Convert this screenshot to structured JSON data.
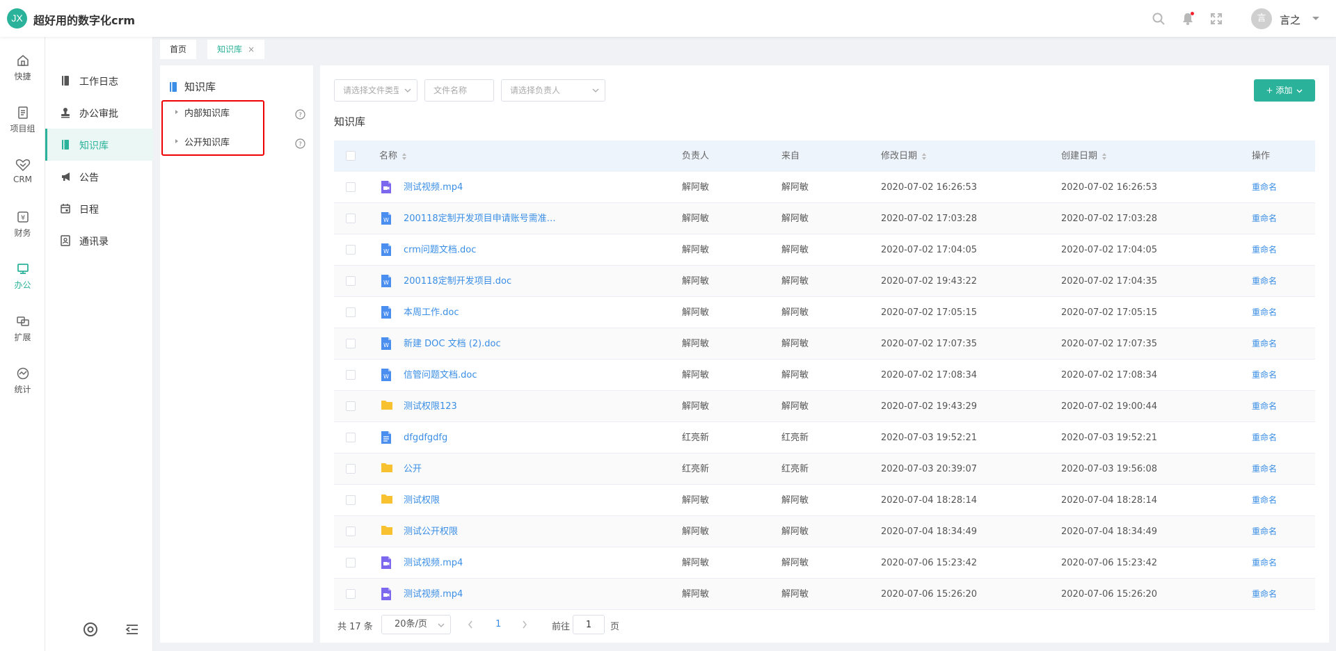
{
  "app": {
    "logo_text": "JX",
    "title": "超好用的数字化crm"
  },
  "user": {
    "avatar_text": "言",
    "name": "言之"
  },
  "rail": [
    {
      "label": "快捷",
      "icon": "home-icon"
    },
    {
      "label": "项目组",
      "icon": "document-icon"
    },
    {
      "label": "CRM",
      "icon": "handshake-icon"
    },
    {
      "label": "财务",
      "icon": "finance-icon"
    },
    {
      "label": "办公",
      "icon": "monitor-icon",
      "active": true
    },
    {
      "label": "扩展",
      "icon": "extend-icon"
    },
    {
      "label": "统计",
      "icon": "stats-icon"
    }
  ],
  "submenu": [
    {
      "label": "工作日志",
      "icon": "journal-icon"
    },
    {
      "label": "办公审批",
      "icon": "stamp-icon"
    },
    {
      "label": "知识库",
      "icon": "knowledge-icon",
      "active": true
    },
    {
      "label": "公告",
      "icon": "megaphone-icon"
    },
    {
      "label": "日程",
      "icon": "calendar-icon"
    },
    {
      "label": "通讯录",
      "icon": "contacts-icon"
    }
  ],
  "tabs": [
    {
      "label": "首页"
    },
    {
      "label": "知识库",
      "close": "×",
      "active": true
    }
  ],
  "tree": {
    "title": "知识库",
    "nodes": [
      {
        "label": "内部知识库"
      },
      {
        "label": "公开知识库"
      }
    ]
  },
  "filters": {
    "file_type_placeholder": "请选择文件类型",
    "file_name_placeholder": "文件名称",
    "owner_placeholder": "请选择负责人"
  },
  "add_button": "添加",
  "main_title": "知识库",
  "table": {
    "headers": {
      "name": "名称",
      "owner": "负责人",
      "source": "来自",
      "modified": "修改日期",
      "created": "创建日期",
      "action": "操作"
    },
    "rows": [
      {
        "type": "video",
        "name": "测试视频.mp4",
        "owner": "解阿敏",
        "source": "解阿敏",
        "modified": "2020-07-02 16:26:53",
        "created": "2020-07-02 16:26:53",
        "action": "重命名"
      },
      {
        "type": "word",
        "name": " 200118定制开发项目申请账号需准备...",
        "owner": "解阿敏",
        "source": "解阿敏",
        "modified": "2020-07-02 17:03:28",
        "created": "2020-07-02 17:03:28",
        "action": "重命名"
      },
      {
        "type": "word",
        "name": "crm问题文档.doc",
        "owner": "解阿敏",
        "source": "解阿敏",
        "modified": "2020-07-02 17:04:05",
        "created": "2020-07-02 17:04:05",
        "action": "重命名"
      },
      {
        "type": "word",
        "name": "200118定制开发项目.doc",
        "owner": "解阿敏",
        "source": "解阿敏",
        "modified": "2020-07-02 19:43:22",
        "created": "2020-07-02 17:04:35",
        "action": "重命名"
      },
      {
        "type": "word",
        "name": "本周工作.doc",
        "owner": "解阿敏",
        "source": "解阿敏",
        "modified": "2020-07-02 17:05:15",
        "created": "2020-07-02 17:05:15",
        "action": "重命名"
      },
      {
        "type": "word",
        "name": "新建 DOC 文档 (2).doc",
        "owner": "解阿敏",
        "source": "解阿敏",
        "modified": "2020-07-02 17:07:35",
        "created": "2020-07-02 17:07:35",
        "action": "重命名"
      },
      {
        "type": "word",
        "name": "信管问题文档.doc",
        "owner": "解阿敏",
        "source": "解阿敏",
        "modified": "2020-07-02 17:08:34",
        "created": "2020-07-02 17:08:34",
        "action": "重命名"
      },
      {
        "type": "folder",
        "name": "测试权限123",
        "owner": "解阿敏",
        "source": "解阿敏",
        "modified": "2020-07-02 19:43:29",
        "created": "2020-07-02 19:00:44",
        "action": "重命名"
      },
      {
        "type": "text",
        "name": "dfgdfgdfg",
        "owner": "红亮新",
        "source": "红亮新",
        "modified": "2020-07-03 19:52:21",
        "created": "2020-07-03 19:52:21",
        "action": "重命名"
      },
      {
        "type": "folder",
        "name": "公开",
        "owner": "红亮新",
        "source": "红亮新",
        "modified": "2020-07-03 20:39:07",
        "created": "2020-07-03 19:56:08",
        "action": "重命名"
      },
      {
        "type": "folder",
        "name": "测试权限",
        "owner": "解阿敏",
        "source": "解阿敏",
        "modified": "2020-07-04 18:28:14",
        "created": "2020-07-04 18:28:14",
        "action": "重命名"
      },
      {
        "type": "folder",
        "name": "测试公开权限",
        "owner": "解阿敏",
        "source": "解阿敏",
        "modified": "2020-07-04 18:34:49",
        "created": "2020-07-04 18:34:49",
        "action": "重命名"
      },
      {
        "type": "video",
        "name": "测试视频.mp4",
        "owner": "解阿敏",
        "source": "解阿敏",
        "modified": "2020-07-06 15:23:42",
        "created": "2020-07-06 15:23:42",
        "action": "重命名"
      },
      {
        "type": "video",
        "name": "测试视频.mp4",
        "owner": "解阿敏",
        "source": "解阿敏",
        "modified": "2020-07-06 15:26:20",
        "created": "2020-07-06 15:26:20",
        "action": "重命名"
      }
    ]
  },
  "pagination": {
    "total": "共 17 条",
    "page_size": "20条/页",
    "current": "1",
    "goto_label": "前往",
    "goto_value": "1",
    "page_suffix": "页"
  },
  "colors": {
    "accent": "#2bb29a",
    "link": "#3a8ee6",
    "highlight": "#e00000"
  }
}
